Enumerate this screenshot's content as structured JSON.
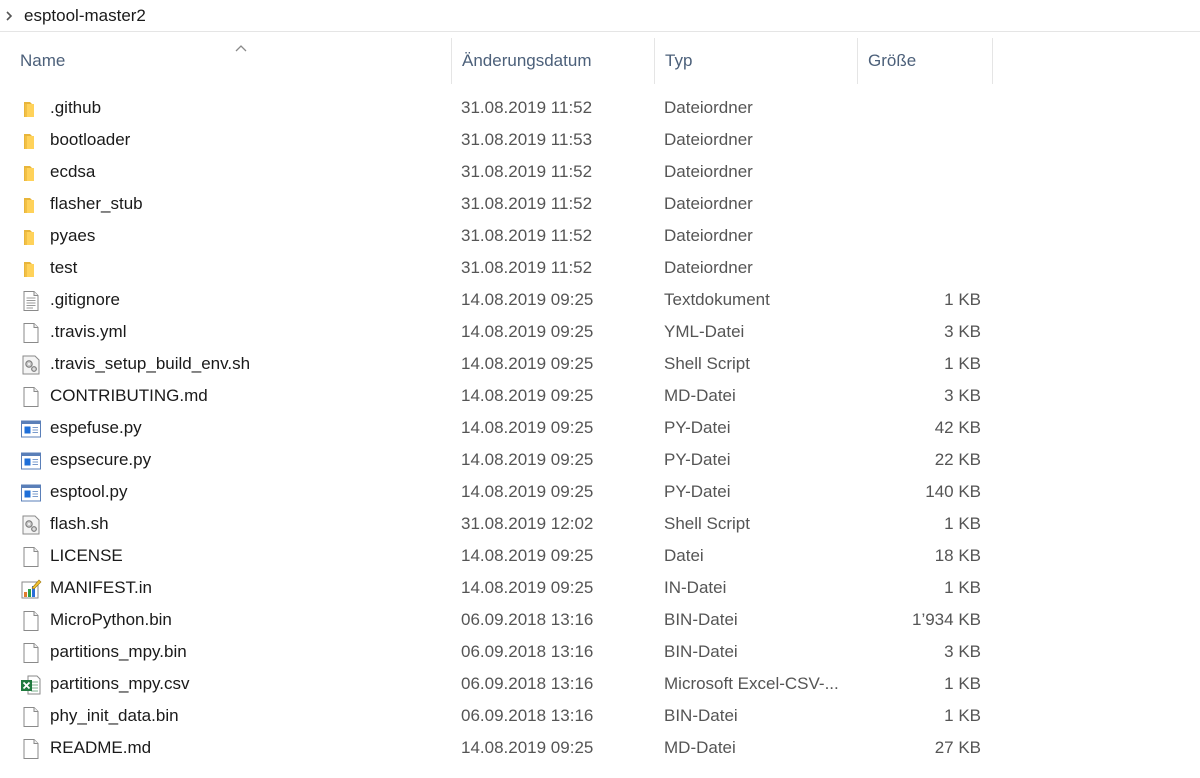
{
  "breadcrumb": {
    "path": "esptool-master2"
  },
  "columns": {
    "name": "Name",
    "date": "Änderungsdatum",
    "type": "Typ",
    "size": "Größe"
  },
  "icon_names": {
    "folder": "folder-icon",
    "text": "text-document-icon",
    "blank": "file-icon",
    "script": "shell-script-icon",
    "py": "python-file-icon",
    "manifest": "manifest-file-icon",
    "excel": "excel-csv-icon"
  },
  "colors": {
    "folder_yellow": "#ffd25a",
    "header_text": "#4c607a",
    "excel_green": "#1f7a3e",
    "py_blue": "#1e6fd9"
  },
  "files": [
    {
      "name": ".github",
      "date": "31.08.2019 11:52",
      "type": "Dateiordner",
      "size": "",
      "icon": "folder"
    },
    {
      "name": "bootloader",
      "date": "31.08.2019 11:53",
      "type": "Dateiordner",
      "size": "",
      "icon": "folder"
    },
    {
      "name": "ecdsa",
      "date": "31.08.2019 11:52",
      "type": "Dateiordner",
      "size": "",
      "icon": "folder"
    },
    {
      "name": "flasher_stub",
      "date": "31.08.2019 11:52",
      "type": "Dateiordner",
      "size": "",
      "icon": "folder"
    },
    {
      "name": "pyaes",
      "date": "31.08.2019 11:52",
      "type": "Dateiordner",
      "size": "",
      "icon": "folder"
    },
    {
      "name": "test",
      "date": "31.08.2019 11:52",
      "type": "Dateiordner",
      "size": "",
      "icon": "folder"
    },
    {
      "name": ".gitignore",
      "date": "14.08.2019 09:25",
      "type": "Textdokument",
      "size": "1 KB",
      "icon": "text"
    },
    {
      "name": ".travis.yml",
      "date": "14.08.2019 09:25",
      "type": "YML-Datei",
      "size": "3 KB",
      "icon": "blank"
    },
    {
      "name": ".travis_setup_build_env.sh",
      "date": "14.08.2019 09:25",
      "type": "Shell Script",
      "size": "1 KB",
      "icon": "script"
    },
    {
      "name": "CONTRIBUTING.md",
      "date": "14.08.2019 09:25",
      "type": "MD-Datei",
      "size": "3 KB",
      "icon": "blank"
    },
    {
      "name": "espefuse.py",
      "date": "14.08.2019 09:25",
      "type": "PY-Datei",
      "size": "42 KB",
      "icon": "py"
    },
    {
      "name": "espsecure.py",
      "date": "14.08.2019 09:25",
      "type": "PY-Datei",
      "size": "22 KB",
      "icon": "py"
    },
    {
      "name": "esptool.py",
      "date": "14.08.2019 09:25",
      "type": "PY-Datei",
      "size": "140 KB",
      "icon": "py"
    },
    {
      "name": "flash.sh",
      "date": "31.08.2019 12:02",
      "type": "Shell Script",
      "size": "1 KB",
      "icon": "script"
    },
    {
      "name": "LICENSE",
      "date": "14.08.2019 09:25",
      "type": "Datei",
      "size": "18 KB",
      "icon": "blank"
    },
    {
      "name": "MANIFEST.in",
      "date": "14.08.2019 09:25",
      "type": "IN-Datei",
      "size": "1 KB",
      "icon": "manifest"
    },
    {
      "name": "MicroPython.bin",
      "date": "06.09.2018 13:16",
      "type": "BIN-Datei",
      "size": "1’934 KB",
      "icon": "blank"
    },
    {
      "name": "partitions_mpy.bin",
      "date": "06.09.2018 13:16",
      "type": "BIN-Datei",
      "size": "3 KB",
      "icon": "blank"
    },
    {
      "name": "partitions_mpy.csv",
      "date": "06.09.2018 13:16",
      "type": "Microsoft Excel-CSV-...",
      "size": "1 KB",
      "icon": "excel"
    },
    {
      "name": "phy_init_data.bin",
      "date": "06.09.2018 13:16",
      "type": "BIN-Datei",
      "size": "1 KB",
      "icon": "blank"
    },
    {
      "name": "README.md",
      "date": "14.08.2019 09:25",
      "type": "MD-Datei",
      "size": "27 KB",
      "icon": "blank"
    }
  ]
}
